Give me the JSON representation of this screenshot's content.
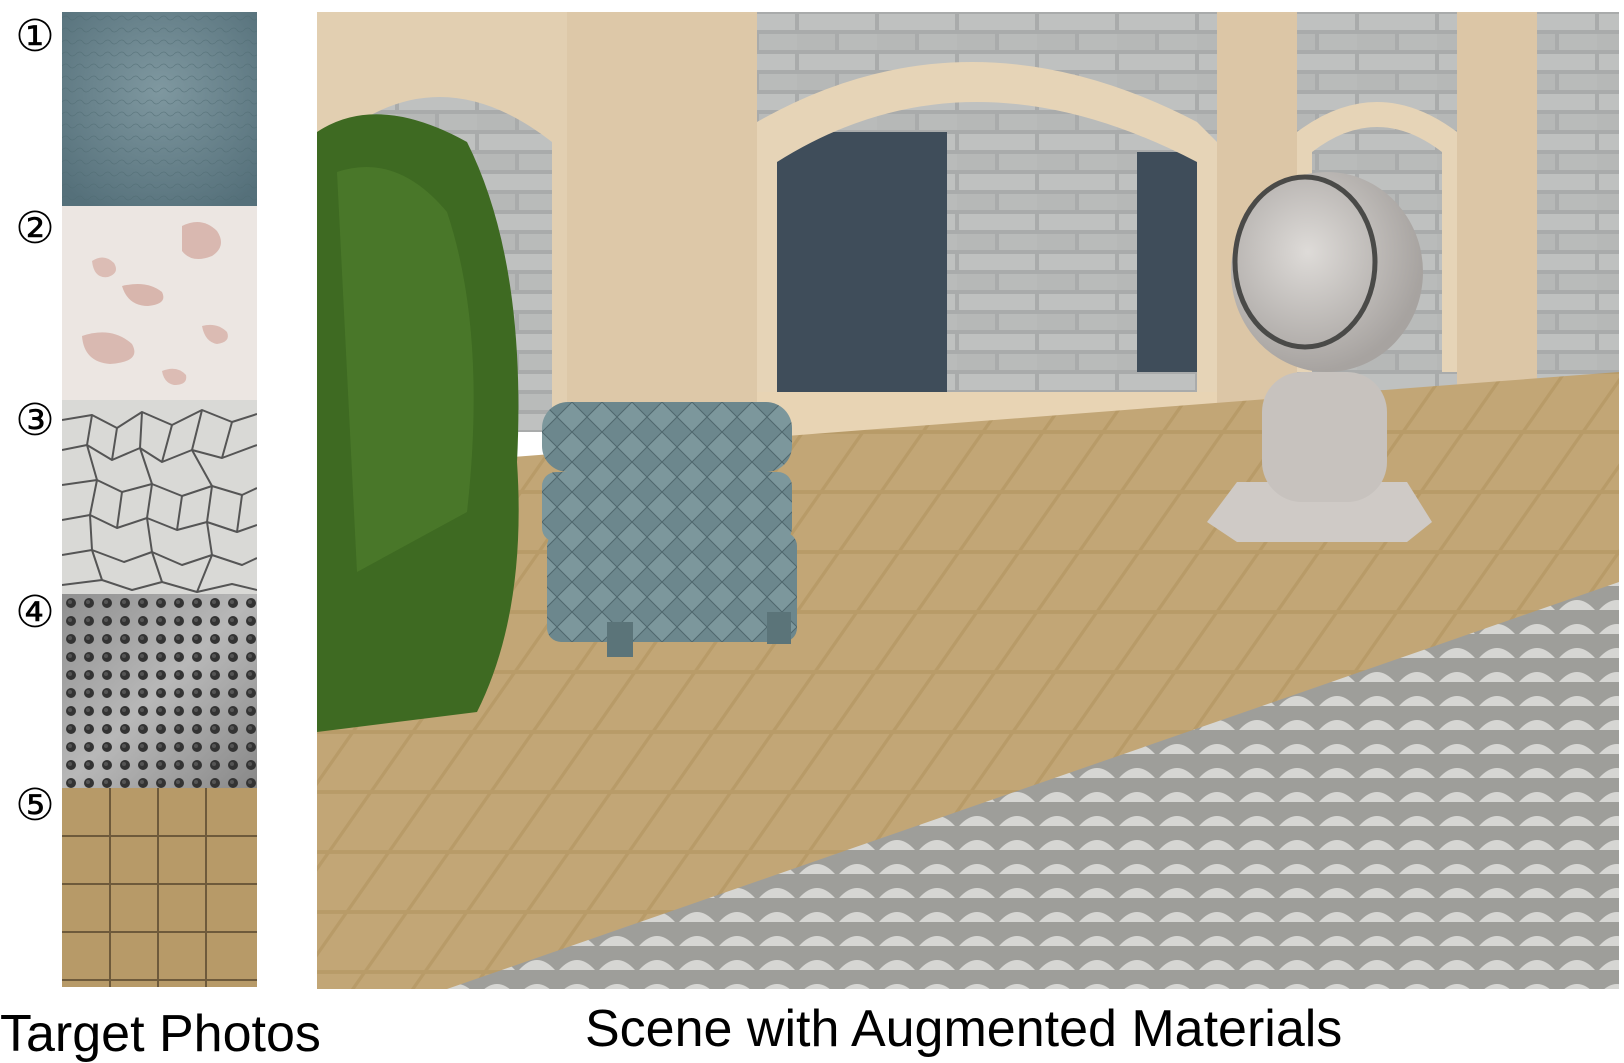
{
  "target_photos": {
    "caption": "Target Photos",
    "items": [
      {
        "marker": "①",
        "material": "blue-grey leather"
      },
      {
        "marker": "②",
        "material": "peeling white plaster"
      },
      {
        "marker": "③",
        "material": "cracked white paving"
      },
      {
        "marker": "④",
        "material": "perforated metal"
      },
      {
        "marker": "⑤",
        "material": "sandy square tiles"
      }
    ]
  },
  "scene": {
    "caption": "Scene with Augmented Materials"
  },
  "colors": {
    "leather": "#6b858d",
    "plaster": "#ece6e2",
    "plaster_spot": "#d9b8b0",
    "crack_tile": "#d9d9d6",
    "metal": "#9a9a9a",
    "sand_tile": "#b79a68",
    "stone_wall": "#e2cfb1",
    "brick": "#b7b9b9",
    "hedge": "#3e6a22",
    "cobble": "#cfcfcc"
  }
}
